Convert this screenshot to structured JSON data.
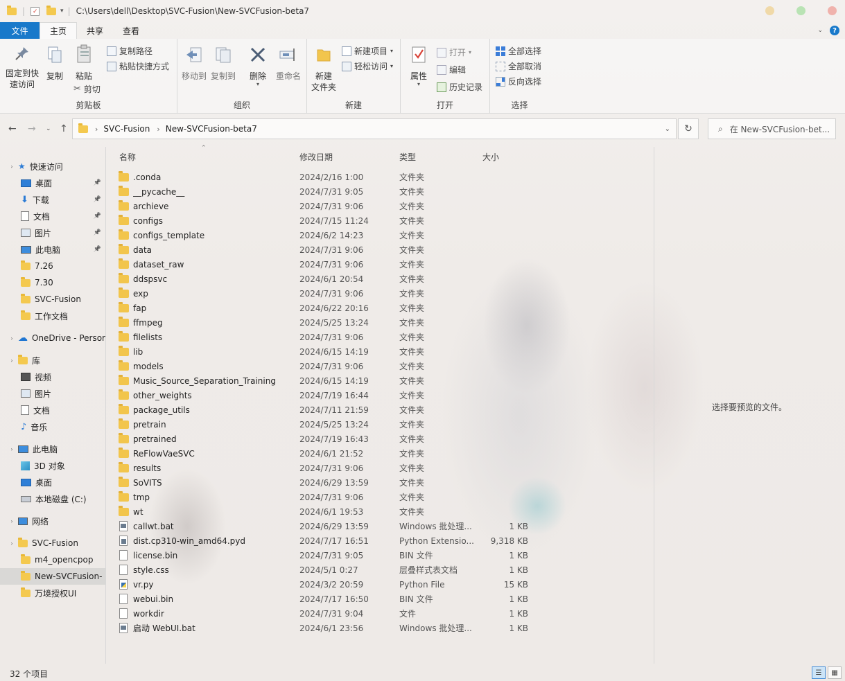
{
  "window": {
    "path": "C:\\Users\\dell\\Desktop\\SVC-Fusion\\New-SVCFusion-beta7",
    "dot_colors": [
      "#f0d9a8",
      "#b9e3b4",
      "#f0b2ac"
    ]
  },
  "tabs": [
    {
      "label": "文件"
    },
    {
      "label": "主页"
    },
    {
      "label": "共享"
    },
    {
      "label": "查看"
    }
  ],
  "ribbon": {
    "clipboard": {
      "pin": "固定到快\n速访问",
      "copy": "复制",
      "paste": "粘贴",
      "copy_path": "复制路径",
      "paste_shortcut": "粘贴快捷方式",
      "cut": "剪切",
      "label": "剪贴板"
    },
    "organize": {
      "move_to": "移动到",
      "copy_to": "复制到",
      "delete": "删除",
      "rename": "重命名",
      "label": "组织"
    },
    "new": {
      "new_folder": "新建\n文件夹",
      "new_item": "新建项目",
      "easy_access": "轻松访问",
      "label": "新建"
    },
    "open": {
      "properties": "属性",
      "open": "打开",
      "edit": "编辑",
      "history": "历史记录",
      "label": "打开"
    },
    "select": {
      "select_all": "全部选择",
      "select_none": "全部取消",
      "invert": "反向选择",
      "label": "选择"
    }
  },
  "address": {
    "crumbs": [
      "SVC-Fusion",
      "New-SVCFusion-beta7"
    ],
    "search_placeholder": "在 New-SVCFusion-bet..."
  },
  "sidebar": {
    "items": [
      {
        "label": "快速访问",
        "icon": "star-icon",
        "pinned": false,
        "indent": 0
      },
      {
        "label": "桌面",
        "icon": "desktop-icon",
        "pinned": true,
        "indent": 1
      },
      {
        "label": "下载",
        "icon": "download-icon",
        "pinned": true,
        "indent": 1
      },
      {
        "label": "文档",
        "icon": "document-icon",
        "pinned": true,
        "indent": 1
      },
      {
        "label": "图片",
        "icon": "picture-icon",
        "pinned": true,
        "indent": 1
      },
      {
        "label": "此电脑",
        "icon": "computer-icon",
        "pinned": true,
        "indent": 1
      },
      {
        "label": "7.26",
        "icon": "folder-icon",
        "pinned": false,
        "indent": 1
      },
      {
        "label": "7.30",
        "icon": "folder-icon",
        "pinned": false,
        "indent": 1
      },
      {
        "label": "SVC-Fusion",
        "icon": "folder-icon",
        "pinned": false,
        "indent": 1
      },
      {
        "label": "工作文档",
        "icon": "folder-icon",
        "pinned": false,
        "indent": 1
      },
      {
        "label": "OneDrive - Persor",
        "icon": "cloud-icon",
        "pinned": false,
        "indent": 0
      },
      {
        "label": "库",
        "icon": "library-icon",
        "pinned": false,
        "indent": 0
      },
      {
        "label": "视频",
        "icon": "video-icon",
        "pinned": false,
        "indent": 1
      },
      {
        "label": "图片",
        "icon": "picture-icon",
        "pinned": false,
        "indent": 1
      },
      {
        "label": "文档",
        "icon": "document-icon",
        "pinned": false,
        "indent": 1
      },
      {
        "label": "音乐",
        "icon": "music-icon",
        "pinned": false,
        "indent": 1
      },
      {
        "label": "此电脑",
        "icon": "computer-icon",
        "pinned": false,
        "indent": 0
      },
      {
        "label": "3D 对象",
        "icon": "cube-icon",
        "pinned": false,
        "indent": 1
      },
      {
        "label": "桌面",
        "icon": "desktop-icon",
        "pinned": false,
        "indent": 1
      },
      {
        "label": "本地磁盘 (C:)",
        "icon": "drive-icon",
        "pinned": false,
        "indent": 1
      },
      {
        "label": "网络",
        "icon": "network-icon",
        "pinned": false,
        "indent": 0
      },
      {
        "label": "SVC-Fusion",
        "icon": "folder-icon",
        "pinned": false,
        "indent": 0
      },
      {
        "label": "m4_opencpop",
        "icon": "folder-icon",
        "pinned": false,
        "indent": 1
      },
      {
        "label": "New-SVCFusion-",
        "icon": "folder-icon",
        "pinned": false,
        "indent": 1
      },
      {
        "label": "万境授权UI",
        "icon": "folder-icon",
        "pinned": false,
        "indent": 1
      }
    ]
  },
  "columns": {
    "name": "名称",
    "date": "修改日期",
    "type": "类型",
    "size": "大小"
  },
  "files": [
    {
      "name": ".conda",
      "date": "2024/2/16 1:00",
      "type": "文件夹",
      "size": "",
      "kind": "folder"
    },
    {
      "name": "__pycache__",
      "date": "2024/7/31 9:05",
      "type": "文件夹",
      "size": "",
      "kind": "folder"
    },
    {
      "name": "archieve",
      "date": "2024/7/31 9:06",
      "type": "文件夹",
      "size": "",
      "kind": "folder"
    },
    {
      "name": "configs",
      "date": "2024/7/15 11:24",
      "type": "文件夹",
      "size": "",
      "kind": "folder"
    },
    {
      "name": "configs_template",
      "date": "2024/6/2 14:23",
      "type": "文件夹",
      "size": "",
      "kind": "folder"
    },
    {
      "name": "data",
      "date": "2024/7/31 9:06",
      "type": "文件夹",
      "size": "",
      "kind": "folder"
    },
    {
      "name": "dataset_raw",
      "date": "2024/7/31 9:06",
      "type": "文件夹",
      "size": "",
      "kind": "folder"
    },
    {
      "name": "ddspsvc",
      "date": "2024/6/1 20:54",
      "type": "文件夹",
      "size": "",
      "kind": "folder"
    },
    {
      "name": "exp",
      "date": "2024/7/31 9:06",
      "type": "文件夹",
      "size": "",
      "kind": "folder"
    },
    {
      "name": "fap",
      "date": "2024/6/22 20:16",
      "type": "文件夹",
      "size": "",
      "kind": "folder"
    },
    {
      "name": "ffmpeg",
      "date": "2024/5/25 13:24",
      "type": "文件夹",
      "size": "",
      "kind": "folder"
    },
    {
      "name": "filelists",
      "date": "2024/7/31 9:06",
      "type": "文件夹",
      "size": "",
      "kind": "folder"
    },
    {
      "name": "lib",
      "date": "2024/6/15 14:19",
      "type": "文件夹",
      "size": "",
      "kind": "folder"
    },
    {
      "name": "models",
      "date": "2024/7/31 9:06",
      "type": "文件夹",
      "size": "",
      "kind": "folder"
    },
    {
      "name": "Music_Source_Separation_Training",
      "date": "2024/6/15 14:19",
      "type": "文件夹",
      "size": "",
      "kind": "folder"
    },
    {
      "name": "other_weights",
      "date": "2024/7/19 16:44",
      "type": "文件夹",
      "size": "",
      "kind": "folder"
    },
    {
      "name": "package_utils",
      "date": "2024/7/11 21:59",
      "type": "文件夹",
      "size": "",
      "kind": "folder"
    },
    {
      "name": "pretrain",
      "date": "2024/5/25 13:24",
      "type": "文件夹",
      "size": "",
      "kind": "folder"
    },
    {
      "name": "pretrained",
      "date": "2024/7/19 16:43",
      "type": "文件夹",
      "size": "",
      "kind": "folder"
    },
    {
      "name": "ReFlowVaeSVC",
      "date": "2024/6/1 21:52",
      "type": "文件夹",
      "size": "",
      "kind": "folder"
    },
    {
      "name": "results",
      "date": "2024/7/31 9:06",
      "type": "文件夹",
      "size": "",
      "kind": "folder"
    },
    {
      "name": "SoVITS",
      "date": "2024/6/29 13:59",
      "type": "文件夹",
      "size": "",
      "kind": "folder"
    },
    {
      "name": "tmp",
      "date": "2024/7/31 9:06",
      "type": "文件夹",
      "size": "",
      "kind": "folder"
    },
    {
      "name": "wt",
      "date": "2024/6/1 19:53",
      "type": "文件夹",
      "size": "",
      "kind": "folder"
    },
    {
      "name": "callwt.bat",
      "date": "2024/6/29 13:59",
      "type": "Windows 批处理...",
      "size": "1 KB",
      "kind": "bat"
    },
    {
      "name": "dist.cp310-win_amd64.pyd",
      "date": "2024/7/17 16:51",
      "type": "Python Extensio...",
      "size": "9,318 KB",
      "kind": "pyd"
    },
    {
      "name": "license.bin",
      "date": "2024/7/31 9:05",
      "type": "BIN 文件",
      "size": "1 KB",
      "kind": "file"
    },
    {
      "name": "style.css",
      "date": "2024/5/1 0:27",
      "type": "层叠样式表文档",
      "size": "1 KB",
      "kind": "css"
    },
    {
      "name": "vr.py",
      "date": "2024/3/2 20:59",
      "type": "Python File",
      "size": "15 KB",
      "kind": "py"
    },
    {
      "name": "webui.bin",
      "date": "2024/7/17 16:50",
      "type": "BIN 文件",
      "size": "1 KB",
      "kind": "file"
    },
    {
      "name": "workdir",
      "date": "2024/7/31 9:04",
      "type": "文件",
      "size": "1 KB",
      "kind": "file"
    },
    {
      "name": "启动 WebUI.bat",
      "date": "2024/6/1 23:56",
      "type": "Windows 批处理...",
      "size": "1 KB",
      "kind": "bat"
    }
  ],
  "preview": {
    "text": "选择要预览的文件。"
  },
  "status": {
    "count": "32 个项目"
  }
}
